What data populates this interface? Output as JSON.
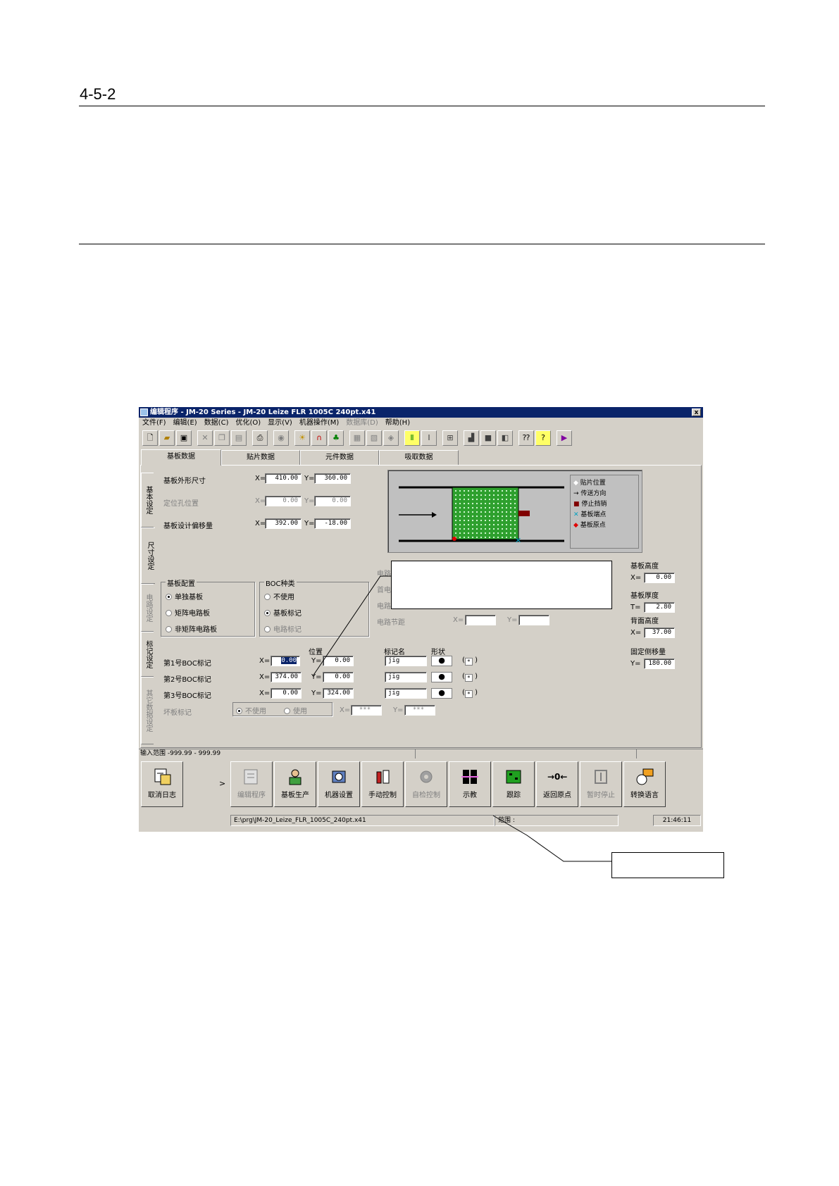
{
  "page": {
    "heading": "4-5-2"
  },
  "window": {
    "title": "编辑程序 - JM-20 Series - JM-20 Leize FLR 1005C 240pt.x41",
    "close_label": "x",
    "menu": [
      {
        "label": "文件(F)",
        "enabled": true
      },
      {
        "label": "编辑(E)",
        "enabled": true
      },
      {
        "label": "数据(C)",
        "enabled": true
      },
      {
        "label": "优化(O)",
        "enabled": true
      },
      {
        "label": "显示(V)",
        "enabled": true
      },
      {
        "label": "机器操作(M)",
        "enabled": true
      },
      {
        "label": "数据库(D)",
        "enabled": false
      },
      {
        "label": "帮助(H)",
        "enabled": true
      }
    ],
    "toolbar_icons": [
      "new-icon",
      "open-icon",
      "save-icon",
      "cut-icon",
      "copy-icon",
      "paste-icon",
      "print-icon",
      "find-icon",
      "light-icon",
      "magnet-icon",
      "color-icon",
      "grid-icon",
      "layer-icon",
      "cube-icon",
      "align-icon",
      "center-icon",
      "board-icon",
      "move-icon",
      "square-icon",
      "stack-icon",
      "context-help-icon",
      "help-icon",
      "exit-icon"
    ],
    "tabs": [
      "基板数据",
      "贴片数据",
      "元件数据",
      "吸取数据"
    ],
    "side_tabs": [
      {
        "label": "基本设定",
        "enabled": true
      },
      {
        "label": "尺寸设定",
        "enabled": true
      },
      {
        "label": "电路设定",
        "enabled": false
      },
      {
        "label": "标记设定",
        "enabled": true
      },
      {
        "label": "其它数据设定",
        "enabled": false
      }
    ],
    "board": {
      "outline_label": "基板外形尺寸",
      "outline_x": "410.00",
      "outline_y": "360.00",
      "locate_hole_label": "定位孔位置",
      "locate_x": "0.00",
      "locate_y": "0.00",
      "offset_label": "基板设计偏移量",
      "offset_x": "392.00",
      "offset_y": "-18.00",
      "x_prefix": "X=",
      "y_prefix": "Y="
    },
    "legend": [
      "贴片位置",
      "传送方向",
      "停止挡销",
      "基板端点",
      "基板原点"
    ],
    "layout_group": {
      "title": "基板配置",
      "options": [
        "单独基板",
        "矩阵电路板",
        "非矩阵电路板"
      ],
      "selected": 0
    },
    "boc_group": {
      "title": "BOC种类",
      "options": [
        "不使用",
        "基板标记",
        "电路标记"
      ],
      "selected": 1
    },
    "circuit": {
      "offset_label": "电路设计偏移量",
      "first_pos_label": "首电路位置",
      "count_label": "电路数目",
      "pitch_label": "电路节距",
      "x_prefix": "X=",
      "y_prefix": "Y="
    },
    "right_panel": {
      "height_label": "基板高度",
      "height_prefix": "X=",
      "height_value": "0.00",
      "thickness_label": "基板厚度",
      "thickness_prefix": "T=",
      "thickness_value": "2.80",
      "backup_label": "背面高度",
      "backup_prefix": "X=",
      "backup_value": "37.00",
      "fixed_label": "固定侧移量",
      "fixed_prefix": "Y=",
      "fixed_value": "180.00"
    },
    "marks_header": {
      "position": "位置",
      "mark_name": "标记名",
      "shape": "形状"
    },
    "marks": [
      {
        "label": "第1号BOC标记",
        "x": "0.00",
        "y": "0.00",
        "name": "jig",
        "shape": "●",
        "flag": "*"
      },
      {
        "label": "第2号BOC标记",
        "x": "374.00",
        "y": "0.00",
        "name": "jig",
        "shape": "●",
        "flag": "*"
      },
      {
        "label": "第3号BOC标记",
        "x": "0.00",
        "y": "324.00",
        "name": "jig",
        "shape": "●",
        "flag": "*"
      }
    ],
    "bad_mark": {
      "label": "坏板标记",
      "opt1": "不使用",
      "opt2": "使用",
      "x": "***",
      "y": "***",
      "x_prefix": "X=",
      "y_prefix": "Y="
    },
    "status_range": "输入范围 -999.99 - 999.99",
    "bottom_buttons": [
      {
        "label": "取消日志",
        "icon": "log-icon",
        "enabled": true
      },
      {
        "label": "编辑程序",
        "icon": "edit-program-icon",
        "enabled": false
      },
      {
        "label": "基板生产",
        "icon": "production-icon",
        "enabled": true
      },
      {
        "label": "机器设置",
        "icon": "machine-setup-icon",
        "enabled": true
      },
      {
        "label": "手动控制",
        "icon": "manual-control-icon",
        "enabled": true
      },
      {
        "label": "自检控制",
        "icon": "self-check-icon",
        "enabled": false
      },
      {
        "label": "示教",
        "icon": "teach-icon",
        "enabled": true
      },
      {
        "label": "跟踪",
        "icon": "trace-icon",
        "enabled": true
      },
      {
        "label": "返回原点",
        "icon": "home-icon",
        "enabled": true
      },
      {
        "label": "暂时停止",
        "icon": "pause-icon",
        "enabled": false
      },
      {
        "label": "转换语言",
        "icon": "language-icon",
        "enabled": true
      }
    ],
    "path": "E:\\prg\\JM-20_Leize_FLR_1005C_240pt.x41",
    "range_label": "范围 :",
    "time": "21:46:11",
    "chevron": ">"
  },
  "colors": {
    "titlebar": "#0a246a",
    "face": "#d4d0c8",
    "board_green": "#2ea02e",
    "selection": "#0a246a"
  }
}
